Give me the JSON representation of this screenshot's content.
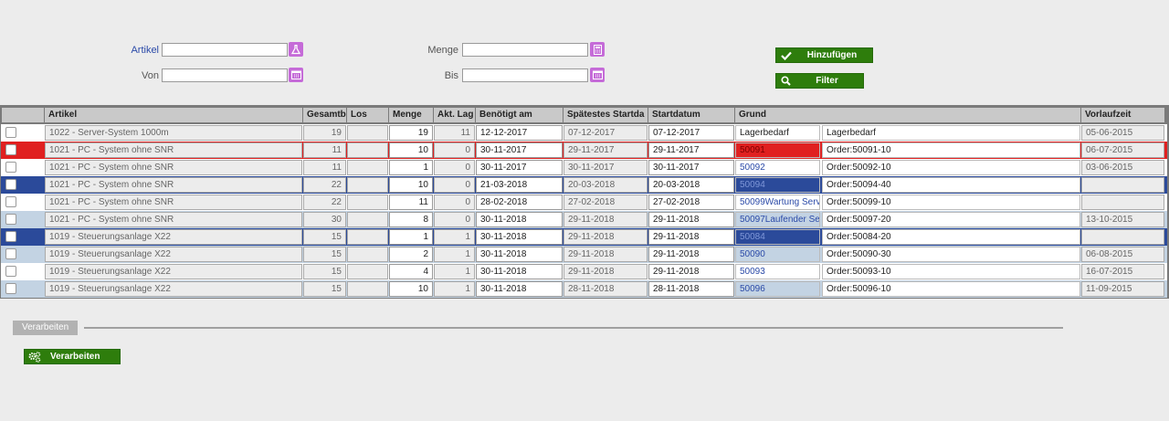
{
  "form": {
    "artikel_label": "Artikel",
    "von_label": "Von",
    "menge_label": "Menge",
    "bis_label": "Bis",
    "artikel_value": "",
    "von_value": "",
    "menge_value": "",
    "bis_value": ""
  },
  "buttons": {
    "add_label": "Hinzufügen",
    "filter_label": "Filter",
    "process_label": "Verarbeiten"
  },
  "section": {
    "tab_label": "Verarbeiten"
  },
  "table": {
    "headers": [
      "Artikel",
      "Gesamtb",
      "Los",
      "Menge",
      "Akt. Lag",
      "Benötigt am",
      "Spätestes Startda",
      "Startdatum",
      "Grund",
      "Vorlaufzeit"
    ],
    "rows": [
      {
        "artikel": "1022 - Server-System 1000m",
        "gesamt": "19",
        "los": "",
        "menge": "19",
        "akt": "11",
        "benoetigt": "12-12-2017",
        "spaetest": "07-12-2017",
        "start": "07-12-2017",
        "grund": "Lagerbedarf",
        "grund2": "Lagerbedarf",
        "vorlauf": "05-06-2015",
        "state": "normal"
      },
      {
        "artikel": "1021 - PC - System ohne SNR",
        "gesamt": "11",
        "los": "",
        "menge": "10",
        "akt": "0",
        "benoetigt": "30-11-2017",
        "spaetest": "29-11-2017",
        "start": "29-11-2017",
        "grund": "50091",
        "grund2": "Order:50091-10",
        "vorlauf": "06-07-2015",
        "state": "red"
      },
      {
        "artikel": "1021 - PC - System ohne SNR",
        "gesamt": "11",
        "los": "",
        "menge": "1",
        "akt": "0",
        "benoetigt": "30-11-2017",
        "spaetest": "30-11-2017",
        "start": "30-11-2017",
        "grund": "50092",
        "grund2": "Order:50092-10",
        "vorlauf": "03-06-2015",
        "state": "normal"
      },
      {
        "artikel": "1021 - PC - System ohne SNR",
        "gesamt": "22",
        "los": "",
        "menge": "10",
        "akt": "0",
        "benoetigt": "21-03-2018",
        "spaetest": "20-03-2018",
        "start": "20-03-2018",
        "grund": "50094",
        "grund2": "Order:50094-40",
        "vorlauf": "",
        "state": "blue"
      },
      {
        "artikel": "1021 - PC - System ohne SNR",
        "gesamt": "22",
        "los": "",
        "menge": "11",
        "akt": "0",
        "benoetigt": "28-02-2018",
        "spaetest": "27-02-2018",
        "start": "27-02-2018",
        "grund": "50099Wartung Serv",
        "grund2": "Order:50099-10",
        "vorlauf": "",
        "state": "normal"
      },
      {
        "artikel": "1021 - PC - System ohne SNR",
        "gesamt": "30",
        "los": "",
        "menge": "8",
        "akt": "0",
        "benoetigt": "30-11-2018",
        "spaetest": "29-11-2018",
        "start": "29-11-2018",
        "grund": "50097Laufender Se",
        "grund2": "Order:50097-20",
        "vorlauf": "13-10-2015",
        "state": "light"
      },
      {
        "artikel": "1019 - Steuerungsanlage X22",
        "gesamt": "15",
        "los": "",
        "menge": "1",
        "akt": "1",
        "benoetigt": "30-11-2018",
        "spaetest": "29-11-2018",
        "start": "29-11-2018",
        "grund": "50084",
        "grund2": "Order:50084-20",
        "vorlauf": "",
        "state": "blue"
      },
      {
        "artikel": "1019 - Steuerungsanlage X22",
        "gesamt": "15",
        "los": "",
        "menge": "2",
        "akt": "1",
        "benoetigt": "30-11-2018",
        "spaetest": "29-11-2018",
        "start": "29-11-2018",
        "grund": "50090",
        "grund2": "Order:50090-30",
        "vorlauf": "06-08-2015",
        "state": "light"
      },
      {
        "artikel": "1019 - Steuerungsanlage X22",
        "gesamt": "15",
        "los": "",
        "menge": "4",
        "akt": "1",
        "benoetigt": "30-11-2018",
        "spaetest": "29-11-2018",
        "start": "29-11-2018",
        "grund": "50093",
        "grund2": "Order:50093-10",
        "vorlauf": "16-07-2015",
        "state": "normal"
      },
      {
        "artikel": "1019 - Steuerungsanlage X22",
        "gesamt": "15",
        "los": "",
        "menge": "10",
        "akt": "1",
        "benoetigt": "30-11-2018",
        "spaetest": "28-11-2018",
        "start": "28-11-2018",
        "grund": "50096",
        "grund2": "Order:50096-10",
        "vorlauf": "11-09-2015",
        "state": "light"
      }
    ]
  },
  "colors": {
    "accent_green": "#2e7d0c",
    "icon_purple": "#c56bd8",
    "row_red": "#e02020",
    "row_blue": "#2b4a9a",
    "row_light": "#c3d3e3"
  },
  "icons": {
    "artikel": "flask-icon",
    "calendar": "calendar-icon",
    "calculator": "calculator-icon",
    "add": "check-icon",
    "filter": "search-icon",
    "process": "gears-icon"
  }
}
